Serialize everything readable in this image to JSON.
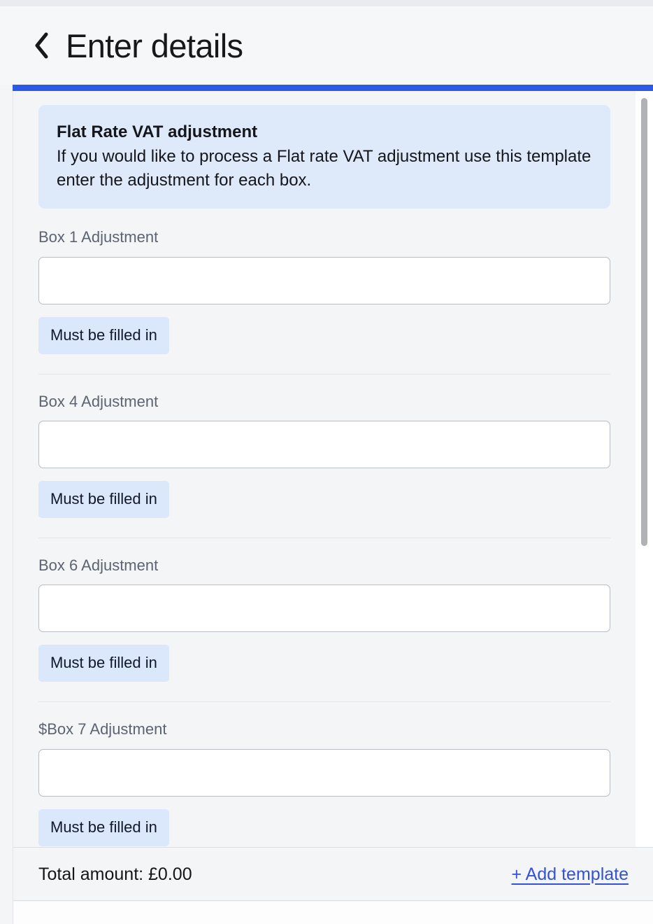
{
  "header": {
    "back_icon": "chevron-left-icon",
    "title": "Enter details"
  },
  "progress": {
    "color": "#2c5ae6",
    "percent": 100
  },
  "info_banner": {
    "title": "Flat Rate VAT adjustment",
    "body": "If you would like to process a Flat rate VAT adjustment use this template enter the adjustment for each box.",
    "background": "#dee9fa"
  },
  "fields": [
    {
      "label": "Box 1 Adjustment",
      "value": "",
      "placeholder": "",
      "error": "Must be filled in"
    },
    {
      "label": "Box 4 Adjustment",
      "value": "",
      "placeholder": "",
      "error": "Must be filled in"
    },
    {
      "label": "Box 6 Adjustment",
      "value": "",
      "placeholder": "",
      "error": "Must be filled in"
    },
    {
      "label": "$Box 7 Adjustment",
      "value": "",
      "placeholder": "",
      "error": "Must be filled in"
    }
  ],
  "footer": {
    "total_label": "Total amount: £0.00",
    "add_template_label": "+ Add template",
    "link_color": "#3452d6"
  }
}
